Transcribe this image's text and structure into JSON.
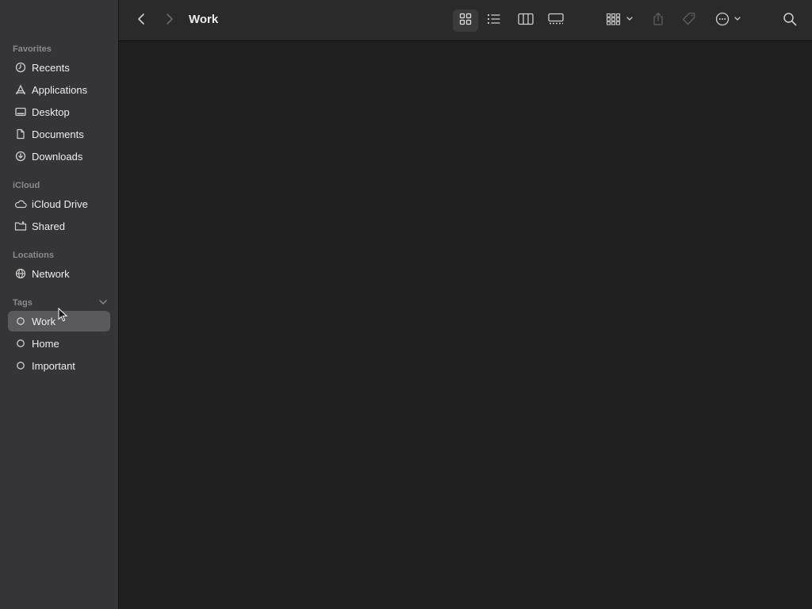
{
  "window": {
    "title": "Work"
  },
  "sidebar": {
    "sections": {
      "favorites": "Favorites",
      "icloud": "iCloud",
      "locations": "Locations",
      "tags": "Tags"
    },
    "favorites": [
      {
        "label": "Recents",
        "icon": "clock-icon"
      },
      {
        "label": "Applications",
        "icon": "applications-icon"
      },
      {
        "label": "Desktop",
        "icon": "desktop-icon"
      },
      {
        "label": "Documents",
        "icon": "document-icon"
      },
      {
        "label": "Downloads",
        "icon": "download-icon"
      }
    ],
    "icloud": [
      {
        "label": "iCloud Drive",
        "icon": "cloud-icon"
      },
      {
        "label": "Shared",
        "icon": "shared-folder-icon"
      }
    ],
    "locations": [
      {
        "label": "Network",
        "icon": "globe-icon"
      }
    ],
    "tags": [
      {
        "label": "Work",
        "icon": "tag-circle-icon",
        "selected": true
      },
      {
        "label": "Home",
        "icon": "tag-circle-icon"
      },
      {
        "label": "Important",
        "icon": "tag-circle-icon"
      }
    ]
  },
  "toolbar": {
    "buttons": [
      "back-icon",
      "forward-icon",
      "icon-view-icon",
      "list-view-icon",
      "column-view-icon",
      "gallery-view-icon",
      "group-icon",
      "share-icon",
      "tag-icon",
      "more-icon",
      "search-icon"
    ],
    "active_view": "icon-view"
  },
  "colors": {
    "sidebar_bg": "#353537",
    "toolbar_bg": "#2a2a2b",
    "content_bg": "#1f1f1f",
    "selection_bg": "#5a5a5c"
  }
}
